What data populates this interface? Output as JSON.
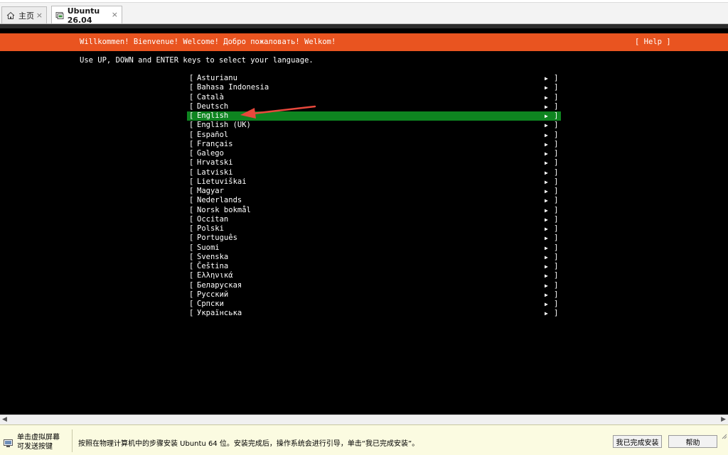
{
  "tabs": [
    {
      "label": "主页",
      "icon": "home-icon"
    },
    {
      "label": "Ubuntu 26.04",
      "icon": "vm-icon"
    }
  ],
  "tab_close_glyph": "×",
  "installer": {
    "banner_title": "Willkommen! Bienvenue! Welcome! Добро пожаловать! Welkom!",
    "help_label": "[ Help ]",
    "instruction": "Use UP, DOWN and ENTER keys to select your language.",
    "selected_language": "English",
    "accent_color": "#e95420",
    "selection_color": "#0e8420",
    "left_bracket": "[",
    "right_bracket": "]",
    "arrow_glyph": "▶",
    "languages": [
      "Asturianu",
      "Bahasa Indonesia",
      "Català",
      "Deutsch",
      "English",
      "English (UK)",
      "Español",
      "Français",
      "Galego",
      "Hrvatski",
      "Latviski",
      "Lietuviškai",
      "Magyar",
      "Nederlands",
      "Norsk bokmål",
      "Occitan",
      "Polski",
      "Português",
      "Suomi",
      "Svenska",
      "Čeština",
      "Ελληνικά",
      "Беларуская",
      "Русский",
      "Српски",
      "Українська"
    ]
  },
  "scrollbar": {
    "left": "◀",
    "right": "▶"
  },
  "hint_bar": {
    "left_line1": "单击虚拟屏幕",
    "left_line2": "可发送按键",
    "message": "按照在物理计算机中的步骤安装 Ubuntu 64 位。安装完成后，操作系统会进行引导，单击“我已完成安装”。",
    "done_button": "我已完成安装",
    "help_button": "帮助"
  }
}
